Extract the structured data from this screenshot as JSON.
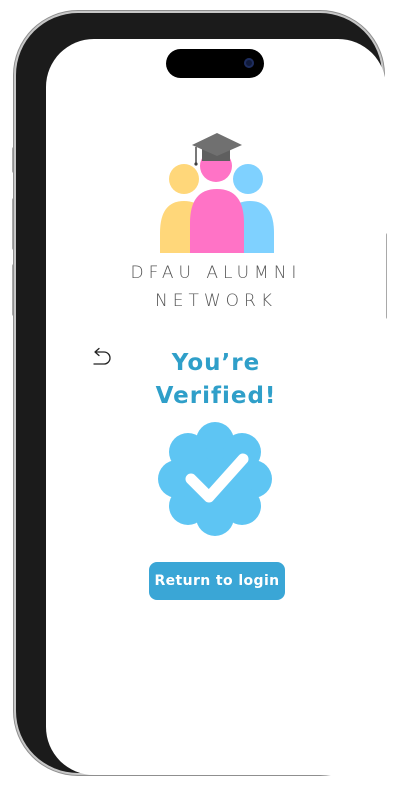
{
  "brand": {
    "line1": "DFAU ALUMNI",
    "line2": "NETWORK",
    "logo_icon": "graduation-people-logo",
    "colors": {
      "yellow": "#ffd77a",
      "pink": "#ff73c6",
      "blue": "#7fd1ff",
      "cap": "#6f6f6f"
    }
  },
  "nav": {
    "back_icon": "undo-arrow-icon"
  },
  "status": {
    "title_line1": "You’re",
    "title_line2": "Verified!",
    "badge_icon": "verified-check-badge-icon",
    "badge_color": "#5ec5f3",
    "title_color": "#2f9fc9"
  },
  "actions": {
    "return_label": "Return to login",
    "button_color": "#3aa6d6"
  }
}
